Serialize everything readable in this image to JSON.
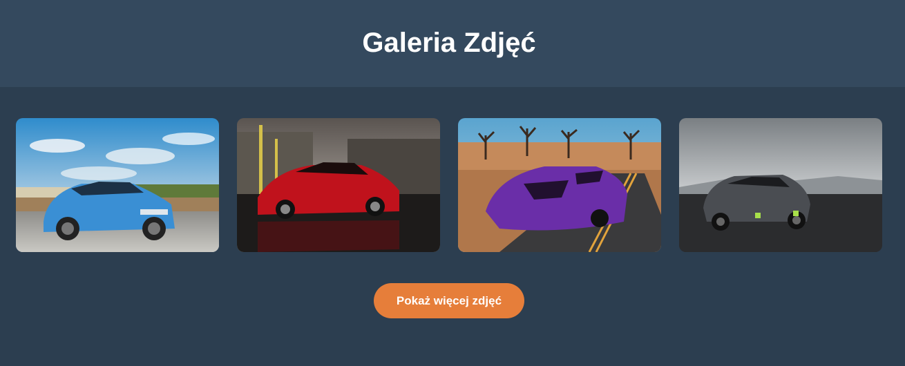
{
  "header": {
    "title": "Galeria Zdjęć"
  },
  "gallery": {
    "photos": [
      {
        "subject": "blue-sedan",
        "color": "#3a8fd4"
      },
      {
        "subject": "red-sports-car",
        "color": "#c0121c"
      },
      {
        "subject": "purple-supercar",
        "color": "#6a2ea8"
      },
      {
        "subject": "grey-hatchback",
        "color": "#4a4d52"
      }
    ]
  },
  "actions": {
    "show_more_label": "Pokaż więcej zdjęć"
  },
  "colors": {
    "header_bg": "#34495e",
    "page_bg": "#2c3e50",
    "button_bg": "#e67e3a",
    "text": "#ffffff"
  }
}
